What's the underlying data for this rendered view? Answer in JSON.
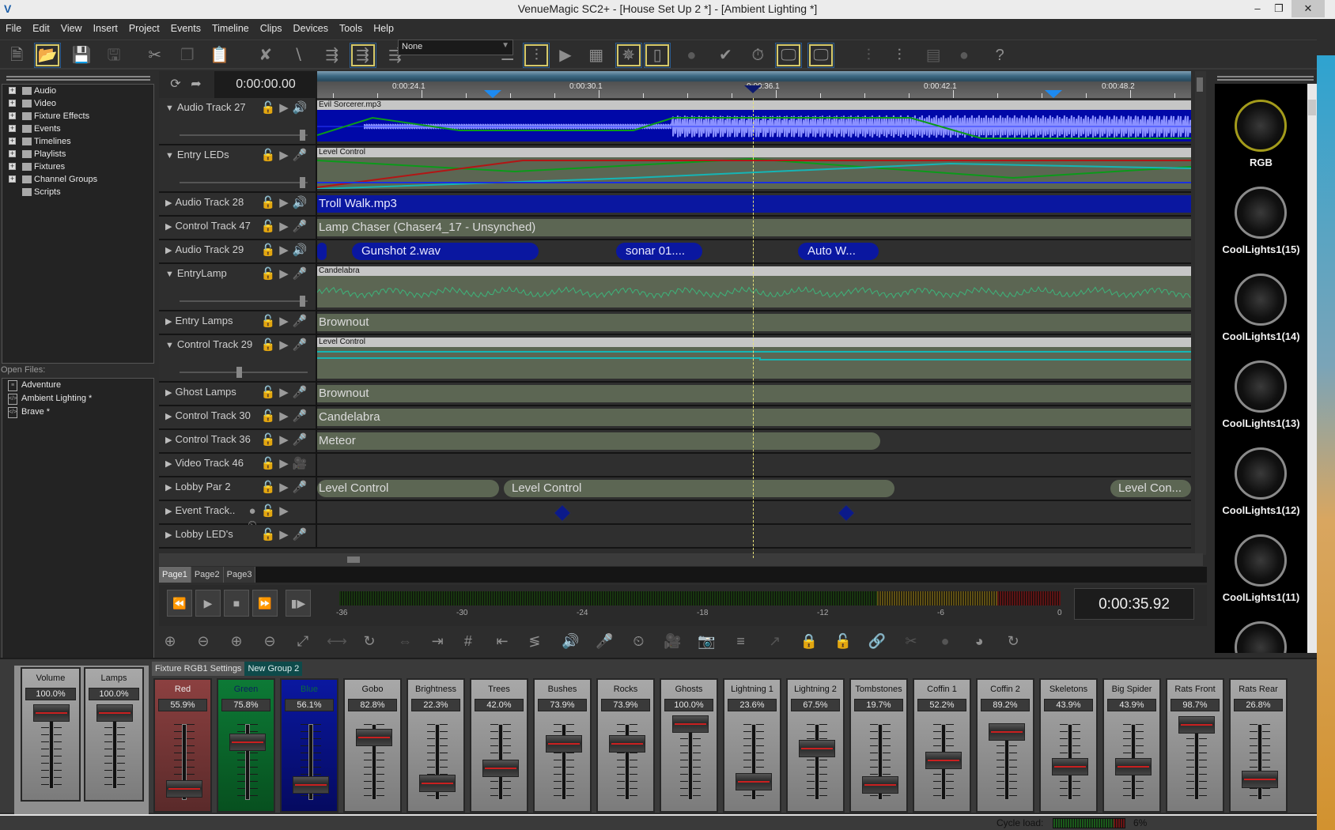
{
  "window": {
    "title": "VenueMagic SC2+ - [House Set Up 2 *] - [Ambient Lighting *]",
    "minimize": "–",
    "maximize": "❐",
    "close": "✕"
  },
  "menu": [
    "File",
    "Edit",
    "View",
    "Insert",
    "Project",
    "Events",
    "Timeline",
    "Clips",
    "Devices",
    "Tools",
    "Help"
  ],
  "toolbar": {
    "dropdown_value": "None",
    "icons": [
      "new-file",
      "open-file",
      "save",
      "save-all",
      "cut",
      "copy",
      "paste",
      "no-fixture",
      "no-link",
      "sequence-list",
      "sequence-step",
      "sequence-next",
      "mixer-stack",
      "faders",
      "video-play",
      "grid",
      "dmx-burst",
      "device-panel",
      "stage-fog",
      "check-clock",
      "timer",
      "screen-in",
      "screen-out",
      "fader-list",
      "fader-add",
      "page-list",
      "fog-list",
      "help-pointer"
    ]
  },
  "tree": {
    "items": [
      "Audio",
      "Video",
      "Fixture Effects",
      "Events",
      "Timelines",
      "Playlists",
      "Fixtures",
      "Channel Groups",
      "Scripts"
    ]
  },
  "open_files": {
    "label": "Open Files:",
    "items": [
      "Adventure",
      "Ambient Lighting *",
      "Brave *"
    ]
  },
  "timeline": {
    "start_time": "0:00:00.00",
    "ruler_labels": [
      "0:00:24.1",
      "0:00:30.1",
      "0:00:36.1",
      "0:00:42.1",
      "0:00:48.2"
    ],
    "tracks": [
      {
        "name": "Audio Track 27",
        "expanded": true,
        "kind": "audio",
        "clips": [
          {
            "label": "Evil Sorcerer.mp3",
            "style": "wave"
          }
        ]
      },
      {
        "name": "Entry LEDs",
        "expanded": true,
        "kind": "control",
        "clips": [
          {
            "label": "Level Control",
            "style": "curves"
          }
        ]
      },
      {
        "name": "Audio Track 28",
        "expanded": false,
        "kind": "audio",
        "clips": [
          {
            "label": "Troll Walk.mp3",
            "style": "blue"
          }
        ]
      },
      {
        "name": "Control Track 47",
        "expanded": false,
        "kind": "control",
        "clips": [
          {
            "label": "Lamp Chaser (Chaser4_17 - Unsynched)",
            "style": "green"
          }
        ]
      },
      {
        "name": "Audio Track 29",
        "expanded": false,
        "kind": "audio",
        "clips": [
          {
            "label": "",
            "style": "bluepill"
          },
          {
            "label": "Gunshot 2.wav",
            "style": "bluepill"
          },
          {
            "label": "sonar 01....",
            "style": "bluepill"
          },
          {
            "label": "Auto W...",
            "style": "bluepill"
          }
        ]
      },
      {
        "name": "EntryLamp",
        "expanded": true,
        "kind": "control",
        "clips": [
          {
            "label": "Candelabra",
            "style": "noise"
          }
        ]
      },
      {
        "name": "Entry Lamps",
        "expanded": false,
        "kind": "control",
        "clips": [
          {
            "label": "Brownout",
            "style": "green"
          }
        ]
      },
      {
        "name": "Control Track 29",
        "expanded": true,
        "kind": "control",
        "clips": [
          {
            "label": "Level Control",
            "style": "flatcurve"
          }
        ]
      },
      {
        "name": "Ghost Lamps",
        "expanded": false,
        "kind": "control",
        "clips": [
          {
            "label": "Brownout",
            "style": "green"
          }
        ]
      },
      {
        "name": "Control Track 30",
        "expanded": false,
        "kind": "control",
        "clips": [
          {
            "label": "Candelabra",
            "style": "green"
          }
        ]
      },
      {
        "name": "Control Track 36",
        "expanded": false,
        "kind": "control",
        "clips": [
          {
            "label": "Meteor",
            "style": "green"
          }
        ]
      },
      {
        "name": "Video Track 46",
        "expanded": false,
        "kind": "video",
        "clips": []
      },
      {
        "name": "Lobby Par 2",
        "expanded": false,
        "kind": "control",
        "clips": [
          {
            "label": "Level Control",
            "style": "greenpill"
          },
          {
            "label": "Level Control",
            "style": "greenpill"
          },
          {
            "label": "Level Con...",
            "style": "greenpill"
          }
        ]
      },
      {
        "name": "Event Track..",
        "expanded": false,
        "kind": "event",
        "clips": []
      },
      {
        "name": "Lobby LED's",
        "expanded": false,
        "kind": "control",
        "clips": []
      }
    ]
  },
  "pages": [
    "Page1",
    "Page2",
    "Page3"
  ],
  "transport": {
    "meter_labels": [
      "-36",
      "-30",
      "-24",
      "-18",
      "-12",
      "-6",
      "0"
    ],
    "current_time": "0:00:35.92"
  },
  "preview": {
    "items": [
      "RGB",
      "CoolLights1(15)",
      "CoolLights1(14)",
      "CoolLights1(13)",
      "CoolLights1(12)",
      "CoolLights1(11)",
      ""
    ]
  },
  "mixer": {
    "masters": [
      {
        "name": "Volume",
        "value": "100.0%",
        "level": 1.0
      },
      {
        "name": "Lamps",
        "value": "100.0%",
        "level": 1.0
      }
    ],
    "tabs": [
      "Fixture RGB1 Settings",
      "New Group 2"
    ],
    "channels": [
      {
        "name": "Red",
        "value": "55.9%",
        "level": 0.15,
        "color": "red"
      },
      {
        "name": "Green",
        "value": "75.8%",
        "level": 0.758,
        "color": "green"
      },
      {
        "name": "Blue",
        "value": "56.1%",
        "level": 0.2,
        "color": "blue"
      },
      {
        "name": "Gobo",
        "value": "82.8%",
        "level": 0.828,
        "color": "gray"
      },
      {
        "name": "Brightness",
        "value": "22.3%",
        "level": 0.223,
        "color": "gray"
      },
      {
        "name": "Trees",
        "value": "42.0%",
        "level": 0.42,
        "color": "gray"
      },
      {
        "name": "Bushes",
        "value": "73.9%",
        "level": 0.739,
        "color": "gray"
      },
      {
        "name": "Rocks",
        "value": "73.9%",
        "level": 0.739,
        "color": "gray"
      },
      {
        "name": "Ghosts",
        "value": "100.0%",
        "level": 1.0,
        "color": "gray"
      },
      {
        "name": "Lightning 1",
        "value": "23.6%",
        "level": 0.236,
        "color": "gray"
      },
      {
        "name": "Lightning 2",
        "value": "67.5%",
        "level": 0.675,
        "color": "gray"
      },
      {
        "name": "Tombstones",
        "value": "19.7%",
        "level": 0.197,
        "color": "gray"
      },
      {
        "name": "Coffin 1",
        "value": "52.2%",
        "level": 0.522,
        "color": "gray"
      },
      {
        "name": "Coffin 2",
        "value": "89.2%",
        "level": 0.892,
        "color": "gray"
      },
      {
        "name": "Skeletons",
        "value": "43.9%",
        "level": 0.439,
        "color": "gray"
      },
      {
        "name": "Big Spider",
        "value": "43.9%",
        "level": 0.439,
        "color": "gray"
      },
      {
        "name": "Rats Front",
        "value": "98.7%",
        "level": 0.987,
        "color": "gray"
      },
      {
        "name": "Rats Rear",
        "value": "26.8%",
        "level": 0.268,
        "color": "gray"
      }
    ]
  },
  "status": {
    "cycle_label": "Cycle load:",
    "cycle_value": "6%",
    "cycle_level": 0.06
  }
}
